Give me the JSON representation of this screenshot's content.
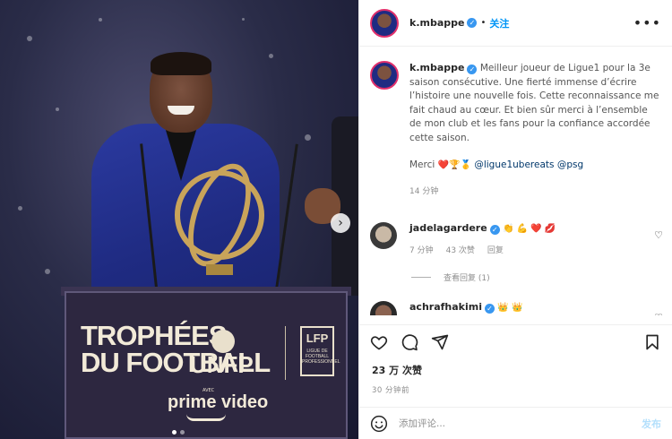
{
  "header": {
    "username": "k.mbappe",
    "dot": "•",
    "follow_label": "关注",
    "more": "•••"
  },
  "caption": {
    "username": "k.mbappe",
    "text": "Meilleur joueur de Ligue1 pour la 3e saison consécutive. Une fierté immense d’écrire l’histoire une nouvelle fois. Cette reconnaissance me fait chaud au cœur. Et bien sûr merci à l’ensemble de mon club et les fans pour la confiance accordée cette saison.",
    "merci": "Merci",
    "emojis": "❤️🏆🥇",
    "mention1": "@ligue1ubereats",
    "mention2": "@psg",
    "time": "14 分钟"
  },
  "comments": [
    {
      "username": "jadelagardere",
      "emojis": "👏 💪 ❤️ 💋",
      "time": "7 分钟",
      "likes": "43 次赞",
      "reply_label": "回复",
      "view_replies": "查看回复 (1)"
    },
    {
      "username": "achrafhakimi",
      "emojis": "👑 👑"
    }
  ],
  "actions": {
    "like_icon": "heart-icon",
    "comment_icon": "comment-icon",
    "share_icon": "share-icon",
    "save_icon": "bookmark-icon"
  },
  "likes": "23 万 次赞",
  "time_ago": "30 分钟前",
  "add_comment": {
    "placeholder": "添加评论...",
    "post_label": "发布"
  },
  "photo": {
    "podium_title_line1": "TROPHÉES",
    "podium_title_line2": "DU FOOTBALL",
    "unfp": "UNFP",
    "lfp": "LFP",
    "lfp_small": "LIGUE DE FOOTBALL PROFESSIONNEL",
    "avec": "AVEC",
    "prime": "prime video"
  },
  "colors": {
    "accent": "#0095f6",
    "verified": "#3897f0",
    "like_red": "#ed4956"
  }
}
